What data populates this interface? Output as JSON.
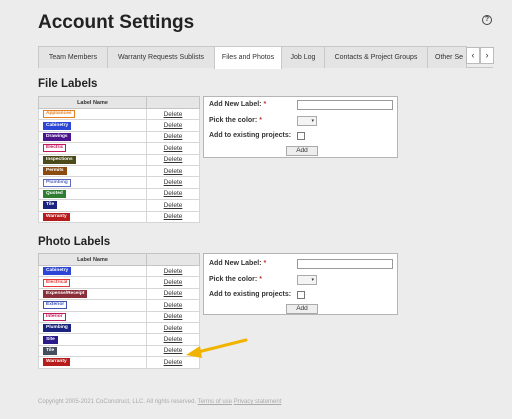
{
  "page_title": "Account Settings",
  "help_icon": "question-icon",
  "tabs": [
    {
      "label": "Team Members",
      "active": false
    },
    {
      "label": "Warranty Requests Sublists",
      "active": false
    },
    {
      "label": "Files and Photos",
      "active": true
    },
    {
      "label": "Job Log",
      "active": false
    },
    {
      "label": "Contacts & Project Groups",
      "active": false
    },
    {
      "label": "Other Se",
      "active": false
    }
  ],
  "tab_arrows": {
    "prev": "‹",
    "next": "›"
  },
  "file_labels": {
    "title": "File Labels",
    "column_header": "Label Name",
    "delete_label": "Delete",
    "rows": [
      {
        "name": "Appliances",
        "color": "#e67e22",
        "outline": true
      },
      {
        "name": "Cabinetry",
        "color": "#2c46d6",
        "outline": false
      },
      {
        "name": "Drawings",
        "color": "#4a148c",
        "outline": false
      },
      {
        "name": "Electric",
        "color": "#c2185b",
        "outline": true
      },
      {
        "name": "Inspections",
        "color": "#4a4a1a",
        "outline": false
      },
      {
        "name": "Permits",
        "color": "#8a4a10",
        "outline": false
      },
      {
        "name": "Plumbing",
        "color": "#5c6bc0",
        "outline": true
      },
      {
        "name": "Quoted",
        "color": "#2e7d32",
        "outline": false
      },
      {
        "name": "Tile",
        "color": "#1a237e",
        "outline": false
      },
      {
        "name": "Warranty",
        "color": "#b71c1c",
        "outline": false
      }
    ]
  },
  "photo_labels": {
    "title": "Photo Labels",
    "column_header": "Label Name",
    "delete_label": "Delete",
    "rows": [
      {
        "name": "Cabinetry",
        "color": "#2c46d6",
        "outline": false
      },
      {
        "name": "Electrical",
        "color": "#e53935",
        "outline": true
      },
      {
        "name": "Expense/Receipt",
        "color": "#8b2f3a",
        "outline": false
      },
      {
        "name": "Exterior",
        "color": "#3f51b5",
        "outline": true
      },
      {
        "name": "Interior",
        "color": "#c2185b",
        "outline": true
      },
      {
        "name": "Plumbing",
        "color": "#1a237e",
        "outline": false
      },
      {
        "name": "Site",
        "color": "#2a1a8a",
        "outline": false
      },
      {
        "name": "Tile",
        "color": "#444c5e",
        "outline": false
      },
      {
        "name": "Warranty",
        "color": "#b71c1c",
        "outline": false
      }
    ]
  },
  "add_form": {
    "new_label": "Add New Label:",
    "pick_color": "Pick the color:",
    "add_existing": "Add to existing projects:",
    "required_mark": "*",
    "add_button": "Add",
    "new_label_value": "",
    "color_caret": "▾"
  },
  "footer": {
    "copyright": "Copyright 2005-2021 CoConstruct, LLC. All rights reserved.",
    "terms": "Terms of use",
    "privacy": "Privacy statement"
  },
  "annotation_arrow_color": "#f0b400"
}
